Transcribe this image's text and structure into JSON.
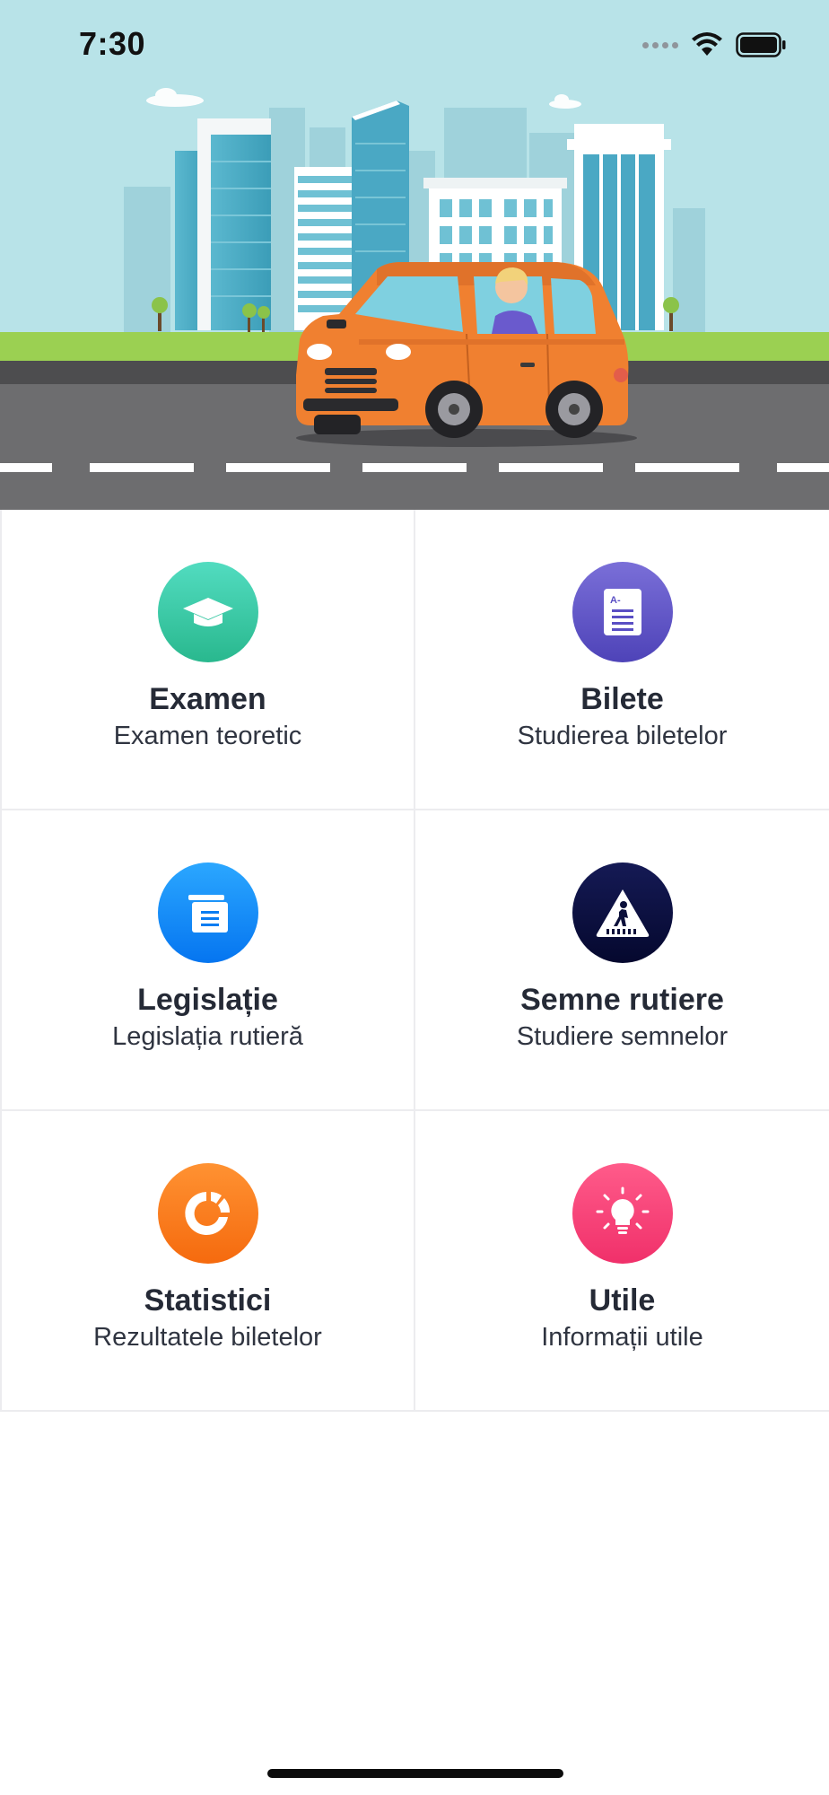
{
  "status_bar": {
    "time": "7:30",
    "signal_icon": "cellular-signal-icon",
    "wifi_icon": "wifi-icon",
    "battery_icon": "battery-icon"
  },
  "hero": {
    "illustration": "city-car-driver-illustration",
    "sky_color": "#b8e3e8",
    "grass_color": "#9bd052",
    "road_color": "#6d6d6f",
    "car_color": "#f08030"
  },
  "menu": [
    {
      "title": "Examen",
      "subtitle": "Examen teoretic",
      "icon": "graduation-cap-icon",
      "color_from": "#52dcc0",
      "color_to": "#29b88e"
    },
    {
      "title": "Bilete",
      "subtitle": "Studierea biletelor",
      "icon": "document-icon",
      "color_from": "#7a6fd8",
      "color_to": "#4e43b8"
    },
    {
      "title": "Legislație",
      "subtitle": "Legislația rutieră",
      "icon": "book-icon",
      "color_from": "#2ba7ff",
      "color_to": "#0575f0"
    },
    {
      "title": "Semne rutiere",
      "subtitle": "Studiere semnelor",
      "icon": "pedestrian-crossing-sign-icon",
      "color_from": "#151a55",
      "color_to": "#05082e"
    },
    {
      "title": "Statistici",
      "subtitle": "Rezultatele biletelor",
      "icon": "pie-chart-icon",
      "color_from": "#ff9232",
      "color_to": "#f56a0e"
    },
    {
      "title": "Utile",
      "subtitle": "Informații utile",
      "icon": "lightbulb-icon",
      "color_from": "#ff5b8a",
      "color_to": "#f0306a"
    }
  ]
}
